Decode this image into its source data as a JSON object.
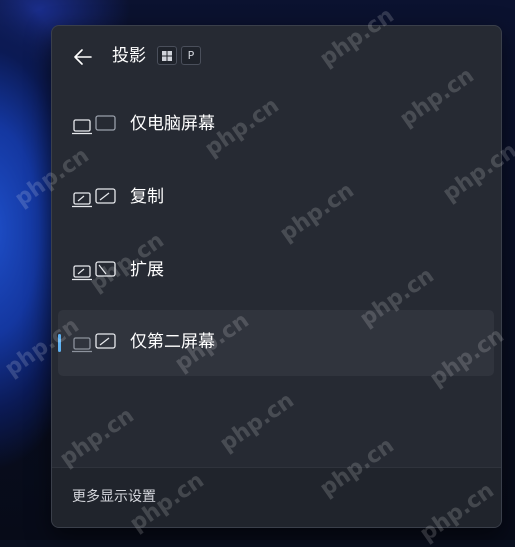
{
  "panel": {
    "title": "投影",
    "back_icon": "arrow-left-icon",
    "shortcut": {
      "win_key_icon": "windows-logo-icon",
      "p_key": "P"
    }
  },
  "options": [
    {
      "label": "仅电脑屏幕",
      "icon": "pc-screen-only-icon",
      "selected": false
    },
    {
      "label": "复制",
      "icon": "duplicate-icon",
      "selected": false
    },
    {
      "label": "扩展",
      "icon": "extend-icon",
      "selected": false
    },
    {
      "label": "仅第二屏幕",
      "icon": "second-screen-only-icon",
      "selected": true
    }
  ],
  "footer": {
    "link": "更多显示设置"
  },
  "colors": {
    "accent": "#5fb2f2",
    "panel_bg": "#262a33",
    "selected_bg": "#30343d"
  },
  "watermark": "php.cn"
}
